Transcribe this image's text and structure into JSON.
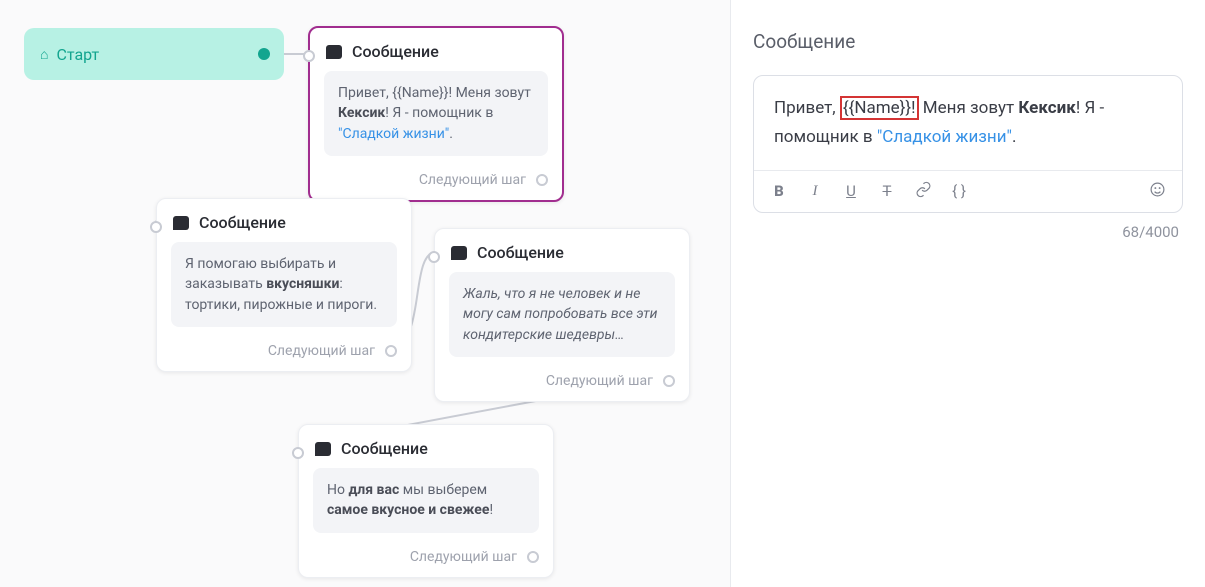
{
  "start": {
    "label": "Старт"
  },
  "nodes": [
    {
      "id": "n1",
      "title": "Сообщение",
      "body_html": "Привет, {{Name}}! Меня зовут <b>Кексик</b>! Я - помощник в <span class='link'>\"Сладкой жизни\"</span>.",
      "next_label": "Следующий шаг"
    },
    {
      "id": "n2",
      "title": "Сообщение",
      "body_html": "Я помогаю выбирать и заказывать <b>вкусняшки</b>: тортики, пирожные и пироги.",
      "next_label": "Следующий шаг"
    },
    {
      "id": "n3",
      "title": "Сообщение",
      "body_html": "<i>Жаль, что я не человек и не могу сам попробовать все эти кондитерские шедевры…</i>",
      "next_label": "Следующий шаг"
    },
    {
      "id": "n4",
      "title": "Сообщение",
      "body_html": "Но <b>для вас</b> мы выберем <b>самое вкусное и свежее</b>!",
      "next_label": "Следующий шаг"
    }
  ],
  "sidebar": {
    "title": "Сообщение",
    "editor_text_parts": {
      "p1": "Привет, ",
      "var": "{{Name}}!",
      "p2": " Меня зовут ",
      "bold": "Кексик",
      "p3": "! Я - помощник в ",
      "link": "\"Сладкой жизни\"",
      "p4": "."
    },
    "counter": "68/4000",
    "toolbar": {
      "bold": "B",
      "italic": "I",
      "underline": "U",
      "strike": "T",
      "braces": "{ }"
    }
  }
}
